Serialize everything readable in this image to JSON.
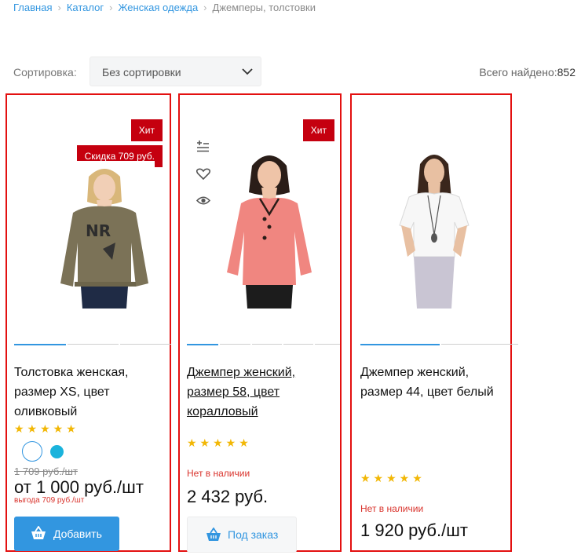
{
  "breadcrumb": [
    "Главная",
    "Каталог",
    "Женская одежда",
    "Джемперы, толстовки"
  ],
  "sort": {
    "label": "Сортировка:",
    "value": "Без сортировки"
  },
  "found": {
    "label": "Всего найдено:",
    "count": "852"
  },
  "colors": {
    "accent": "#3296e0",
    "badge": "#c5000f",
    "frame": "#e31010",
    "star": "#f2b705",
    "alert": "#d9332c"
  },
  "products": [
    {
      "badges": [
        "Хит",
        "Скидка 709 руб."
      ],
      "title": "Толстовка женская, размер XS, цвет оливковый",
      "rating": 5,
      "stars": "★★★★★",
      "swatches": [
        "white",
        "light-blue"
      ],
      "old_price": "1 709 руб./шт",
      "price": "от 1 000 руб./шт",
      "benefit": "выгода 709 руб./шт",
      "button": "Добавить"
    },
    {
      "badges": [
        "Хит"
      ],
      "title": "Джемпер женский, размер 58, цвет коралловый",
      "rating": 5,
      "stars": "★★★★★",
      "availability": "Нет в наличии",
      "price": "2 432 руб.",
      "button": "Под заказ",
      "actions": [
        "compare-icon",
        "heart-icon",
        "eye-icon"
      ]
    },
    {
      "title": "Джемпер женский, размер 44, цвет белый",
      "rating": 5,
      "stars": "★★★★★",
      "availability": "Нет в наличии",
      "price": "1 920 руб./шт"
    }
  ]
}
